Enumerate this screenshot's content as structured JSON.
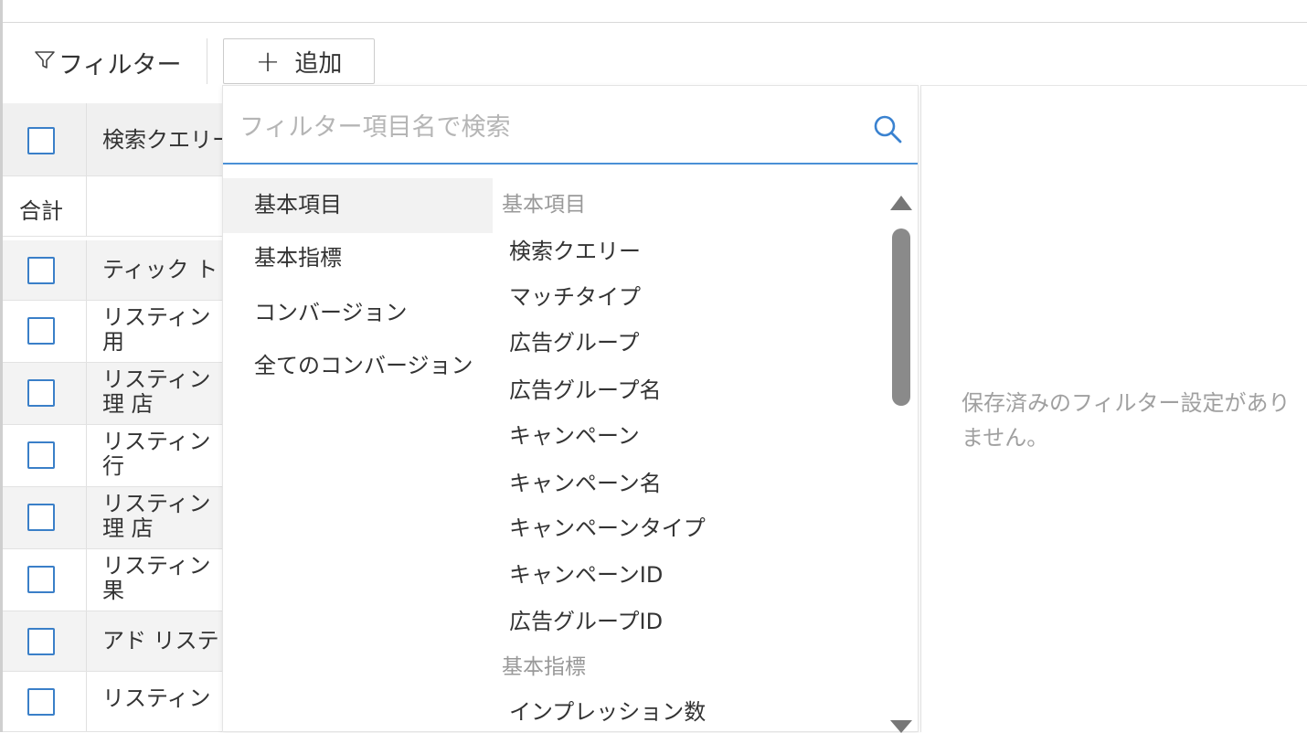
{
  "toolbar": {
    "filter_label": "フィルター",
    "add_label": "追加",
    "add_icon": "plus-icon",
    "filter_icon": "funnel-icon"
  },
  "table": {
    "header": "検索クエリー",
    "total_label": "合計",
    "rows": [
      {
        "line1": "ティック ト",
        "line2": ""
      },
      {
        "line1": "リスティン",
        "line2": "用"
      },
      {
        "line1": "リスティン",
        "line2": "理 店"
      },
      {
        "line1": "リスティン",
        "line2": "行"
      },
      {
        "line1": "リスティン",
        "line2": "理 店"
      },
      {
        "line1": "リスティン",
        "line2": "果"
      },
      {
        "line1": "アド リステ",
        "line2": ""
      },
      {
        "line1": "リスティン",
        "line2": ""
      }
    ]
  },
  "dropdown": {
    "search_placeholder": "フィルター項目名で検索",
    "search_value": "",
    "categories": [
      {
        "label": "基本項目",
        "active": true
      },
      {
        "label": "基本指標",
        "active": false
      },
      {
        "label": "コンバージョン",
        "active": false
      },
      {
        "label": "全てのコンバージョン",
        "active": false
      }
    ],
    "groups": [
      {
        "title": "基本項目",
        "items": [
          "検索クエリー",
          "マッチタイプ",
          "広告グループ",
          "広告グループ名",
          "キャンペーン",
          "キャンペーン名",
          "キャンペーンタイプ",
          "キャンペーンID",
          "広告グループID"
        ]
      },
      {
        "title": "基本指標",
        "items": [
          "インプレッション数"
        ]
      }
    ]
  },
  "saved_filters": {
    "empty_message": "保存済みのフィルター設定がありません。"
  },
  "colors": {
    "accent": "#4a90d6",
    "checkbox_border": "#3a7fc8",
    "muted_text": "#999999"
  }
}
